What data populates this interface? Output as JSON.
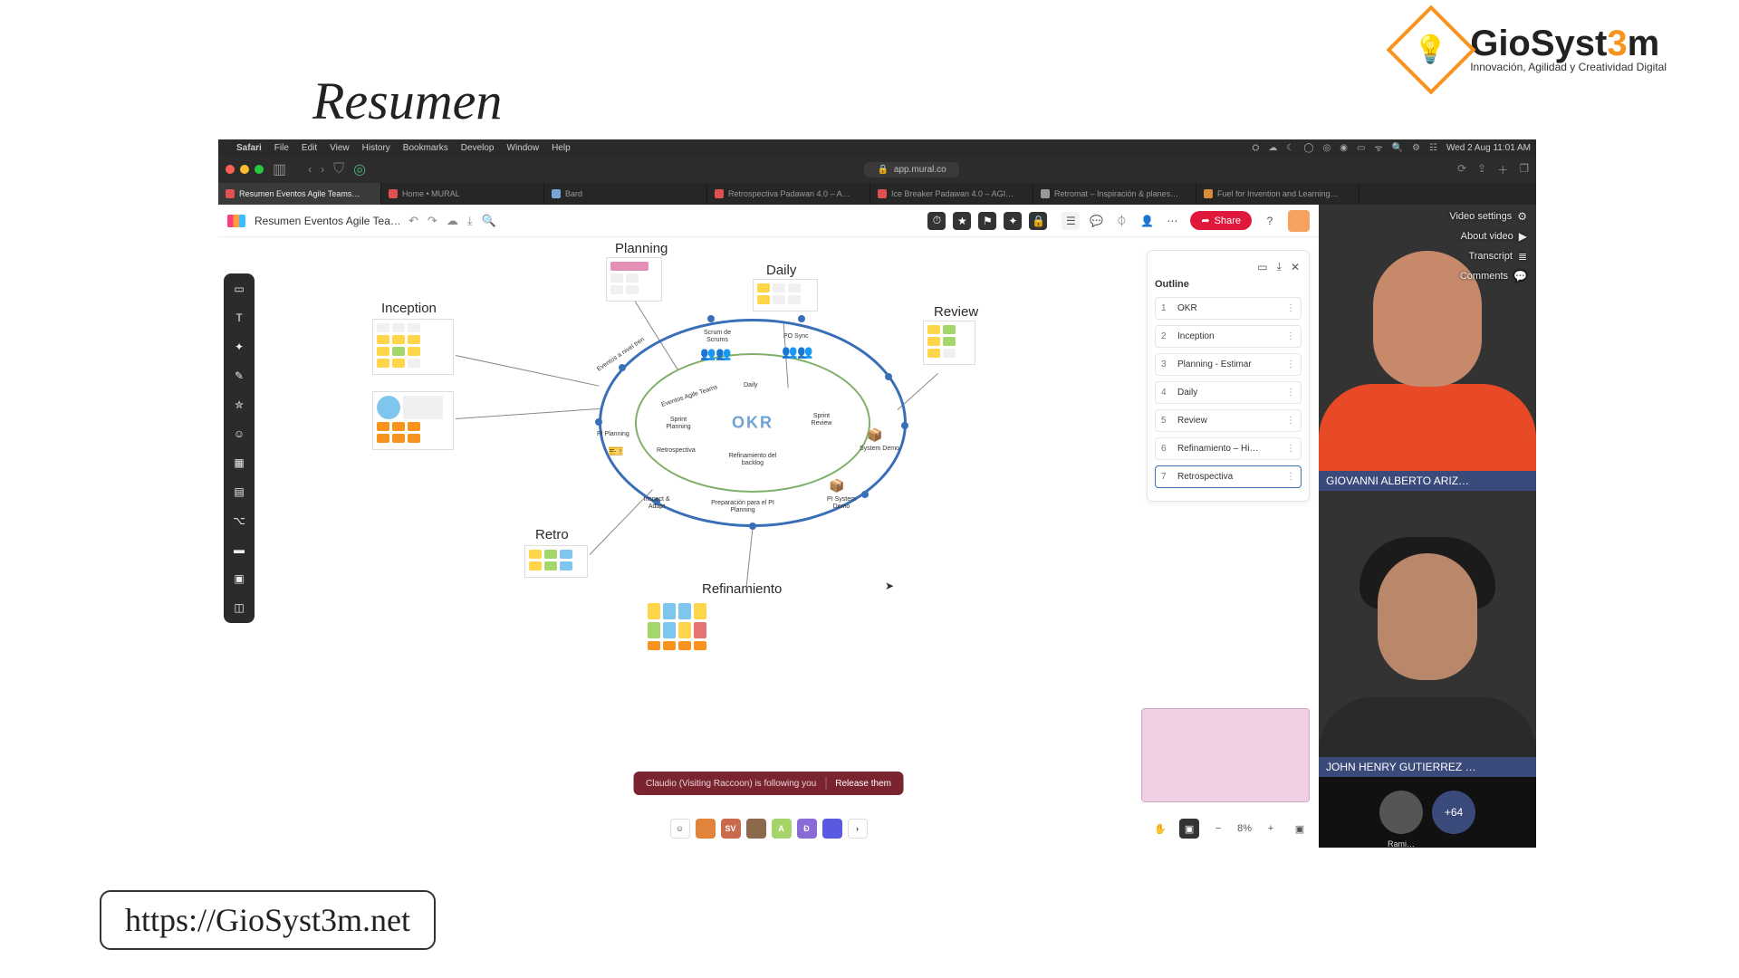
{
  "slide": {
    "title": "Resumen",
    "url_badge": "https://GioSyst3m.net"
  },
  "brand": {
    "name_pre": "GioSyst",
    "name_accent": "3",
    "name_post": "m",
    "tagline": "Innovación, Agilidad y Creatividad Digital"
  },
  "mac_menu": {
    "app": "Safari",
    "items": [
      "File",
      "Edit",
      "View",
      "History",
      "Bookmarks",
      "Develop",
      "Window",
      "Help"
    ],
    "datetime": "Wed 2 Aug  11:01 AM"
  },
  "browser": {
    "address": "app.mural.co",
    "tabs": [
      {
        "label": "Resumen Eventos Agile Teams…",
        "active": true,
        "fav": "m"
      },
      {
        "label": "Home • MURAL",
        "fav": "m"
      },
      {
        "label": "Bard",
        "fav": "b"
      },
      {
        "label": "Retrospectiva Padawan 4.0 – A…",
        "fav": "m"
      },
      {
        "label": "Ice Breaker Padawan 4.0 – AGI…",
        "fav": "m"
      },
      {
        "label": "Retromat – Inspiración & planes…",
        "fav": "r"
      },
      {
        "label": "Fuel for Invention and Learning…",
        "fav": "f"
      }
    ]
  },
  "mural": {
    "doc_title": "Resumen Eventos Agile Tea…",
    "share_label": "Share",
    "outline": {
      "title": "Outline",
      "items": [
        {
          "n": "1",
          "label": "OKR"
        },
        {
          "n": "2",
          "label": "Inception"
        },
        {
          "n": "3",
          "label": "Planning - Estimar"
        },
        {
          "n": "4",
          "label": "Daily"
        },
        {
          "n": "5",
          "label": "Review"
        },
        {
          "n": "6",
          "label": "Refinamiento – Hi…"
        },
        {
          "n": "7",
          "label": "Retrospectiva"
        }
      ],
      "active_index": 6
    },
    "canvas_labels": {
      "inception": "Inception",
      "planning": "Planning",
      "daily": "Daily",
      "review": "Review",
      "retro": "Retro",
      "refinamiento": "Refinamiento",
      "okr": "OKR",
      "ring_outer_note": "Eventos a nivel tren",
      "ring_inner_note": "Eventos Agile Teams",
      "n_scrum": "Scrum de\nScrums",
      "n_posync": "PO Sync",
      "n_piplanning": "PI Planning",
      "n_sprintplanning": "Sprint\nPlanning",
      "n_daily": "Daily",
      "n_sprintreview": "Sprint\nReview",
      "n_systemdemo": "System Demo",
      "n_retro": "Retrospectiva",
      "n_inspect": "Inspect &\nAdapt",
      "n_refback": "Refinamiento\ndel backlog",
      "n_prep": "Preparación para\nel PI Planning",
      "n_pisys": "PI System\nDemo"
    },
    "follow_toast": {
      "text": "Claudio (Visiting Raccoon) is following you",
      "action": "Release them"
    },
    "zoom": "8%",
    "presence_more": "›"
  },
  "video": {
    "menu": [
      "Video settings",
      "About video",
      "Transcript",
      "Comments"
    ],
    "p1": "GIOVANNI ALBERTO ARIZ…",
    "p2": "JOHN HENRY GUTIERREZ …",
    "thumb_label": "Rami…",
    "more_count": "+64"
  }
}
